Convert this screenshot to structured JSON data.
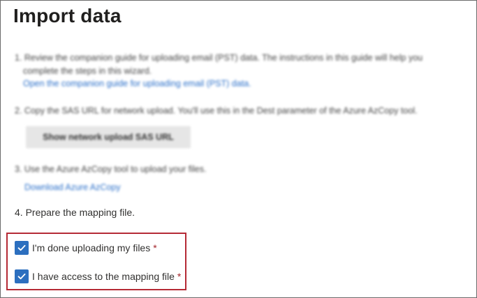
{
  "page": {
    "title": "Import data"
  },
  "steps": {
    "step1_line1": "1. Review the companion guide for uploading email (PST) data. The instructions in this guide will help you",
    "step1_line2": "complete the steps in this wizard.",
    "step1_link": "Open the companion guide for uploading email (PST) data.",
    "step2_text": "2. Copy the SAS URL for network upload. You'll use this in the Dest parameter of the Azure AzCopy tool.",
    "step2_button": "Show network upload SAS URL",
    "step3_text": "3. Use the Azure AzCopy tool to upload your files.",
    "step3_link": "Download Azure AzCopy",
    "step4_text": "4. Prepare the mapping file."
  },
  "checkboxes": [
    {
      "label": "I'm done uploading my files",
      "required_mark": "*",
      "checked": true
    },
    {
      "label": "I have access to the mapping file",
      "required_mark": "*",
      "checked": true
    }
  ],
  "colors": {
    "accent": "#2c6fbf",
    "highlight_border": "#b52a35",
    "required": "#a4262c"
  }
}
